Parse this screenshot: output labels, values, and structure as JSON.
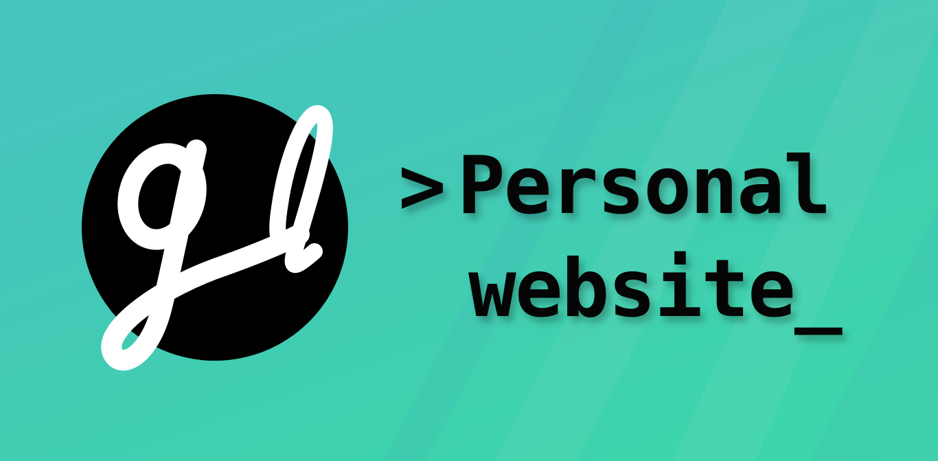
{
  "banner": {
    "logo_text": "gl",
    "prompt_symbol": ">",
    "line1": "Personal",
    "line2": "website_"
  },
  "colors": {
    "background_start": "#47c4c0",
    "background_end": "#3dd6aa",
    "circle": "#000000",
    "logo_letters": "#ffffff",
    "text": "#050505"
  }
}
